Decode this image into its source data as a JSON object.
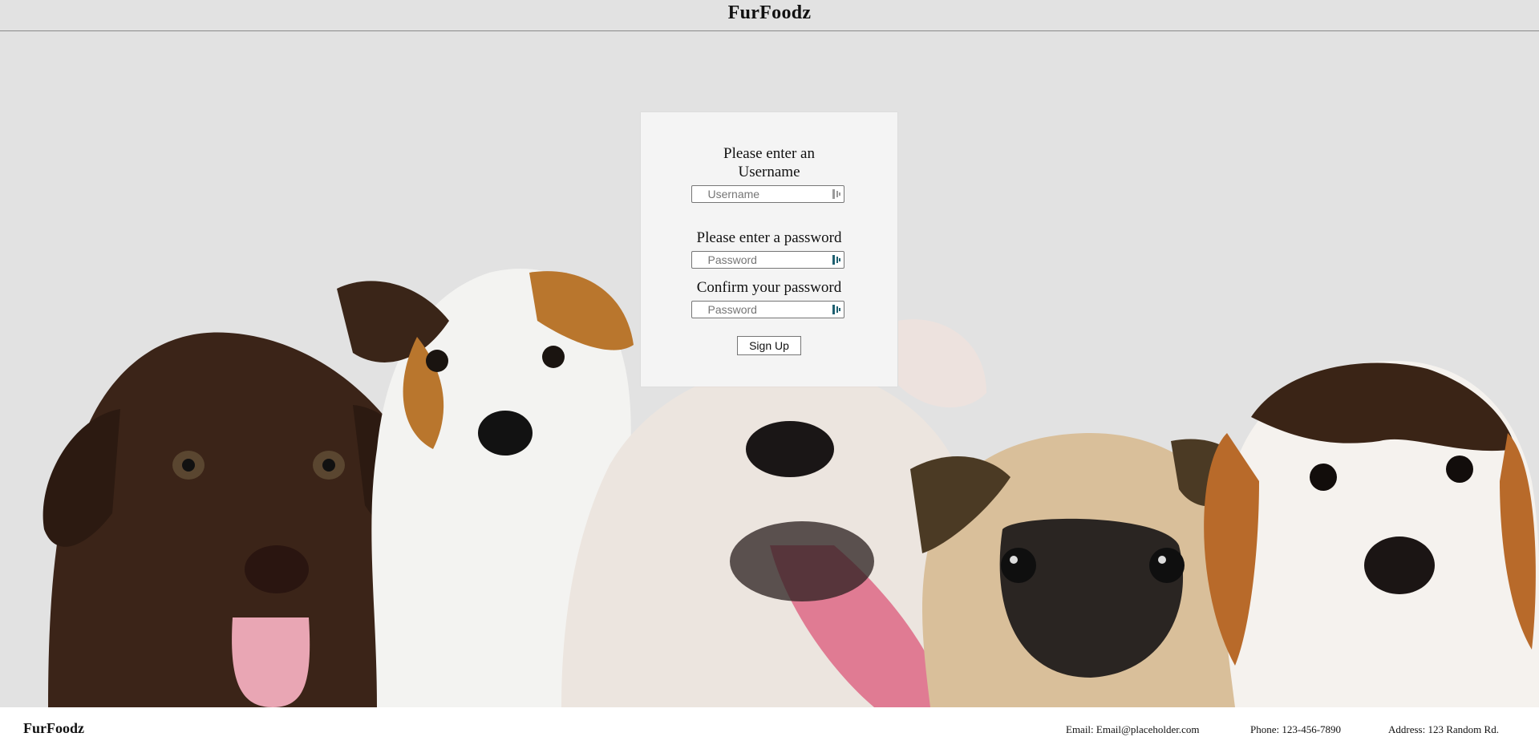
{
  "header": {
    "title": "FurFoodz"
  },
  "hero": {
    "image": "puppies-group-photo"
  },
  "signup_form": {
    "username_prompt": "Please enter an Username",
    "username_placeholder": "Username",
    "username_value": "",
    "password_prompt": "Please enter a password",
    "password_placeholder": "Password",
    "password_value": "",
    "confirm_prompt": "Confirm your password",
    "confirm_placeholder": "Password",
    "confirm_value": "",
    "submit_label": "Sign Up",
    "field_icon": "password-manager-icon"
  },
  "footer": {
    "brand": "FurFoodz",
    "email": "Email: Email@placeholder.com",
    "phone": "Phone: 123-456-7890",
    "address": "Address: 123 Random Rd."
  },
  "colors": {
    "page_background": "#e2e2e2",
    "card_background": "#f4f4f4",
    "footer_background": "#ffffff",
    "icon_accent": "#1e6070"
  }
}
